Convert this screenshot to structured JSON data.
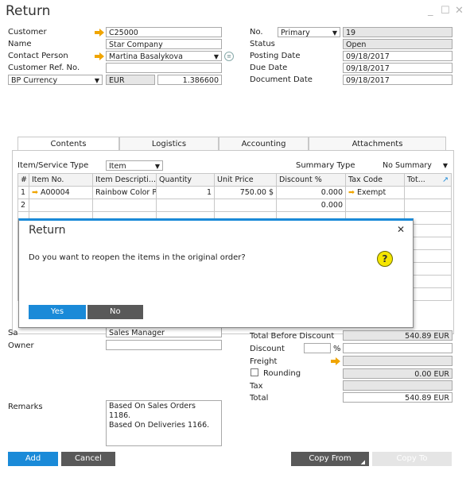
{
  "window": {
    "title": "Return"
  },
  "header_left": {
    "customer": {
      "label": "Customer",
      "value": "C25000"
    },
    "name": {
      "label": "Name",
      "value": "Star Company"
    },
    "contact_person": {
      "label": "Contact Person",
      "value": "Martina  Basalykova"
    },
    "customer_ref": {
      "label": "Customer Ref. No.",
      "value": ""
    },
    "currency": {
      "label": "BP Currency",
      "code": "EUR",
      "rate": "1.386600"
    }
  },
  "header_right": {
    "no": {
      "label": "No.",
      "series": "Primary",
      "value": "19"
    },
    "status": {
      "label": "Status",
      "value": "Open"
    },
    "posting_date": {
      "label": "Posting Date",
      "value": "09/18/2017"
    },
    "due_date": {
      "label": "Due Date",
      "value": "09/18/2017"
    },
    "document_date": {
      "label": "Document Date",
      "value": "09/18/2017"
    }
  },
  "tabs": [
    {
      "label": "Contents"
    },
    {
      "label": "Logistics"
    },
    {
      "label": "Accounting"
    },
    {
      "label": "Attachments"
    }
  ],
  "contents": {
    "item_type_label": "Item/Service Type",
    "item_type_value": "Item",
    "summary_type_label": "Summary Type",
    "summary_type_value": "No Summary",
    "columns": [
      "#",
      "Item No.",
      "Item Descripti...",
      "Quantity",
      "Unit Price",
      "Discount %",
      "Tax Code",
      "Tot..."
    ],
    "rows": [
      {
        "n": "1",
        "item_no": "A00004",
        "desc": "Rainbow Color P",
        "qty": "1",
        "price": "750.00 $",
        "disc": "0.000",
        "tax": "Exempt",
        "total": ""
      },
      {
        "n": "2",
        "item_no": "",
        "desc": "",
        "qty": "",
        "price": "",
        "disc": "0.000",
        "tax": "",
        "total": ""
      }
    ]
  },
  "dialog": {
    "title": "Return",
    "message": "Do you want to reopen the items in the original order?",
    "yes": "Yes",
    "no": "No"
  },
  "footer_left": {
    "sales_employee_label": "Sa",
    "sales_employee_value": "Sales Manager",
    "owner_label": "Owner",
    "owner_value": "",
    "remarks_label": "Remarks",
    "remarks_lines": [
      "Based On Sales Orders 1186.",
      "Based On Deliveries 1166."
    ]
  },
  "totals": {
    "total_before_discount_label": "Total Before Discount",
    "total_before_discount": "540.89 EUR",
    "discount_label": "Discount",
    "discount_pct": "",
    "pct_sign": "%",
    "freight_label": "Freight",
    "rounding_label": "Rounding",
    "rounding_value": "0.00 EUR",
    "tax_label": "Tax",
    "total_label": "Total",
    "total_value": "540.89 EUR"
  },
  "buttons": {
    "add": "Add",
    "cancel": "Cancel",
    "copy_from": "Copy From",
    "copy_to": "Copy To"
  },
  "colors": {
    "accent": "#1a8ad8",
    "arrow": "#f0a500",
    "dark_button": "#555555"
  }
}
